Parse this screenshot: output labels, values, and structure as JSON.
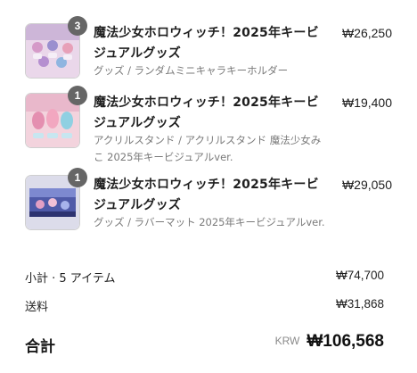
{
  "items": [
    {
      "quantity": "3",
      "title": "魔法少女ホロウィッチ！2025年キービジュアルグッズ",
      "variant": "グッズ / ランダムミニキャラキーホルダー",
      "price": "₩26,250",
      "thumb_colors": [
        "#e9dcea",
        "#c79fcb",
        "#8f8fbf"
      ]
    },
    {
      "quantity": "1",
      "title": "魔法少女ホロウィッチ！2025年キービジュアルグッズ",
      "variant": "アクリルスタンド / アクリルスタンド 魔法少女みこ 2025年キービジュアルver.",
      "price": "₩19,400",
      "thumb_colors": [
        "#f1c8d4",
        "#e79ab4",
        "#8ccfe0"
      ]
    },
    {
      "quantity": "1",
      "title": "魔法少女ホロウィッチ！2025年キービジュアルグッズ",
      "variant": "グッズ / ラバーマット 2025年キービジュアルver.",
      "price": "₩29,050",
      "thumb_colors": [
        "#6f7cc4",
        "#3d4690",
        "#d78fb6"
      ]
    }
  ],
  "summary": {
    "subtotal_label": "小計 · 5 アイテム",
    "subtotal_value": "₩74,700",
    "shipping_label": "送料",
    "shipping_value": "₩31,868"
  },
  "total": {
    "label": "合計",
    "currency_code": "KRW",
    "value": "₩106,568"
  }
}
